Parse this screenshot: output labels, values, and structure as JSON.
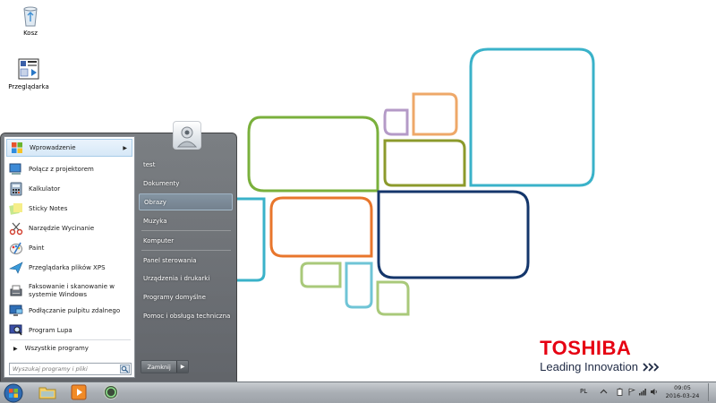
{
  "desktop": {
    "icons": [
      {
        "label": "Kosz"
      },
      {
        "label": "Przeglądarka"
      }
    ],
    "brand": {
      "logo": "TOSHIBA",
      "tagline": "Leading Innovation"
    }
  },
  "start_menu": {
    "programs": [
      {
        "label": "Wprowadzenie",
        "has_submenu": true,
        "icon": "getting-started-icon"
      },
      {
        "label": "Połącz z projektorem",
        "icon": "projector-icon"
      },
      {
        "label": "Kalkulator",
        "icon": "calculator-icon"
      },
      {
        "label": "Sticky Notes",
        "icon": "sticky-notes-icon"
      },
      {
        "label": "Narzędzie Wycinanie",
        "icon": "snipping-tool-icon"
      },
      {
        "label": "Paint",
        "icon": "paint-icon"
      },
      {
        "label": "Przeglądarka plików XPS",
        "icon": "xps-viewer-icon"
      },
      {
        "label": "Faksowanie i skanowanie w systemie Windows",
        "line1": "Faksowanie i skanowanie w",
        "line2": "systemie Windows",
        "icon": "fax-scan-icon"
      },
      {
        "label": "Podłączanie pulpitu zdalnego",
        "icon": "remote-desktop-icon"
      },
      {
        "label": "Program Lupa",
        "icon": "magnifier-icon"
      }
    ],
    "all_programs": "Wszystkie programy",
    "search": {
      "placeholder": "Wyszukaj programy i pliki"
    },
    "right_items": [
      {
        "label": "test"
      },
      {
        "label": "Dokumenty"
      },
      {
        "label": "Obrazy"
      },
      {
        "label": "Muzyka"
      },
      {
        "label": "Komputer"
      },
      {
        "label": "Panel sterowania"
      },
      {
        "label": "Urządzenia i drukarki"
      },
      {
        "label": "Programy domyślne"
      },
      {
        "label": "Pomoc i obsługa techniczna"
      }
    ],
    "shutdown_label": "Zamknij"
  },
  "taskbar": {
    "pinned": [
      {
        "name": "explorer-icon"
      },
      {
        "name": "media-player-icon"
      },
      {
        "name": "app-ring-icon"
      }
    ],
    "tray": {
      "language": "PL",
      "time": "09:05",
      "date": "2016-03-24"
    }
  },
  "colors": {
    "toshiba_red": "#e60012",
    "shape_green": "#7ab03c",
    "shape_orange": "#e8762c",
    "shape_cyan": "#3ab2c9",
    "shape_navy": "#14366b",
    "shape_purple": "#b49ac7",
    "shape_peach": "#eea869",
    "shape_olive": "#8c9a2c",
    "shape_lightgreen": "#a9c97a"
  }
}
